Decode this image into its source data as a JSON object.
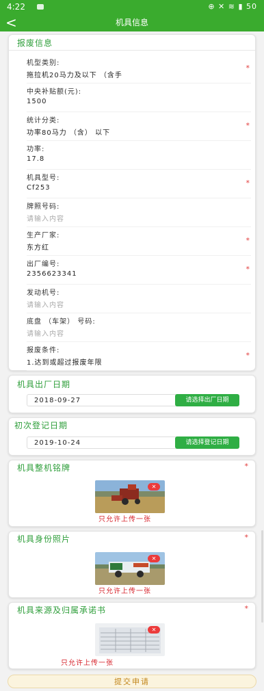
{
  "status": {
    "time": "4:22",
    "icons": "⊕ ✕ ≋ ▮ 50"
  },
  "header": {
    "back": "<",
    "title": "机具信息"
  },
  "scrap_info": {
    "title": "报废信息",
    "fields": [
      {
        "label": "机型类别:",
        "value": "拖拉机20马力及以下 （含手",
        "required": true
      },
      {
        "label": "中央补贴额(元):",
        "value": "1500",
        "required": false
      },
      {
        "label": "统计分类:",
        "value": "功率80马力 （含） 以下",
        "required": true
      },
      {
        "label": "功率:",
        "value": "17.8",
        "required": false
      },
      {
        "label": "机具型号:",
        "value": "Cf253",
        "required": true
      },
      {
        "label": "牌照号码:",
        "value": "",
        "placeholder": "请输入内容",
        "required": false
      },
      {
        "label": "生产厂家:",
        "value": "东方红",
        "required": true
      },
      {
        "label": "出厂编号:",
        "value": "2356623341",
        "required": true
      },
      {
        "label": "发动机号:",
        "value": "",
        "placeholder": "请输入内容",
        "required": false
      },
      {
        "label": "底盘 （车架） 号码:",
        "value": "",
        "placeholder": "请输入内容",
        "required": false
      },
      {
        "label": "报废条件:",
        "value": "1.达到或超过报废年限",
        "required": true
      }
    ]
  },
  "factory_date": {
    "title": "机具出厂日期",
    "value": "2018-09-27",
    "button": "请选择出厂日期"
  },
  "register_date": {
    "title": "初次登记日期",
    "value": "2019-10-24",
    "button": "请选择登记日期"
  },
  "nameplate": {
    "title": "机具整机铭牌",
    "note": "只允许上传一张",
    "remove": "✕"
  },
  "identity_photo": {
    "title": "机具身份照片",
    "note": "只允许上传一张",
    "remove": "✕"
  },
  "source_letter": {
    "title": "机具来源及归属承诺书",
    "note": "只允许上传一张",
    "remove": "✕"
  },
  "required_mark": "*",
  "submit": "提交申请"
}
